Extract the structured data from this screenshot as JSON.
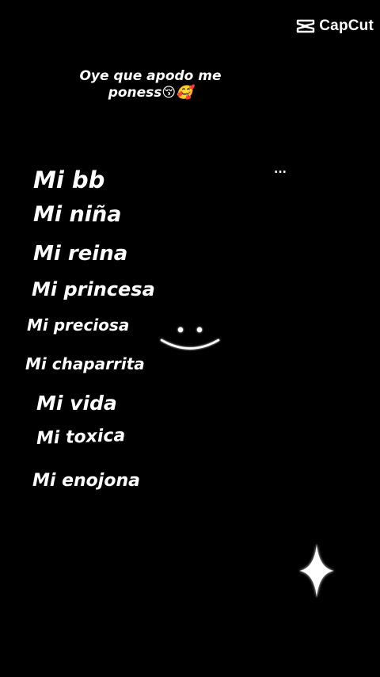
{
  "watermark": {
    "text": "CapCut",
    "icon": "capcut-logo-icon"
  },
  "question": {
    "line1": "Oye que apodo me",
    "line2": "poness",
    "emojis": "😚🥰"
  },
  "dots": "...",
  "nicknames": [
    "Mi bb",
    "Mi niña",
    "Mi reina",
    "Mi princesa",
    "Mi preciosa",
    "Mi chaparrita",
    "Mi vida",
    "Mi toxica",
    "Mi enojona"
  ],
  "decorations": {
    "face": "smiley-face-icon",
    "star": "sparkle-star-icon"
  },
  "colors": {
    "background": "#000000",
    "text": "#ffffff"
  }
}
